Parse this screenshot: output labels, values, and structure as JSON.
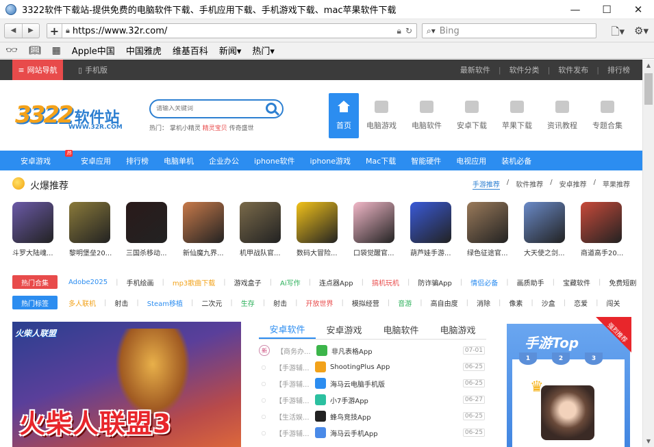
{
  "window": {
    "title": "3322软件下载站-提供免费的电脑软件下载、手机应用下载、手机游戏下载、mac苹果软件下载",
    "controls": {
      "minimize": "—",
      "maximize": "☐",
      "close": "✕"
    }
  },
  "toolbar": {
    "url": "https://www.32r.com/",
    "search_placeholder": "Bing"
  },
  "bookmarks": [
    "Apple中国",
    "中国雅虎",
    "维基百科",
    "新闻▾",
    "热门▾"
  ],
  "topbar": {
    "nav_label": "网站导航",
    "mobile_label": "手机版",
    "right_links": [
      "最新软件",
      "软件分类",
      "软件发布",
      "排行榜"
    ]
  },
  "header": {
    "logo_num": "3322",
    "logo_text": "软件站",
    "logo_sub": "WWW.32R.COM",
    "search_placeholder": "请输入关键词",
    "hot_prefix": "热门：",
    "hot_items": [
      "掌机小精灵",
      "精灵宝贝",
      "传奇盛世"
    ],
    "categories": [
      "首页",
      "电脑游戏",
      "电脑软件",
      "安卓下载",
      "苹果下载",
      "资讯教程",
      "专题合集"
    ]
  },
  "bluenav": {
    "items": [
      "安卓游戏",
      "安卓应用",
      "排行榜",
      "电脑单机",
      "企业办公",
      "iphone软件",
      "iphone游戏",
      "Mac下载",
      "智能硬件",
      "电视应用",
      "装机必备"
    ],
    "badge": "热"
  },
  "hot_section": {
    "title": "火爆推荐",
    "tabs": [
      "手游推荐",
      "软件推荐",
      "安卓推荐",
      "苹果推荐"
    ],
    "tab_sep": "/",
    "games": [
      {
        "name": "斗罗大陆魂...",
        "color": "#6b5aa8"
      },
      {
        "name": "黎明堡垒20...",
        "color": "#8a7a3a"
      },
      {
        "name": "三国杀移动...",
        "color": "#2a1a1a"
      },
      {
        "name": "新仙魔九界...",
        "color": "#c87a4a"
      },
      {
        "name": "机甲战队官...",
        "color": "#7a6a4a"
      },
      {
        "name": "数码大冒险...",
        "color": "#f2c21a"
      },
      {
        "name": "口袋觉醒官...",
        "color": "#f2b8c8"
      },
      {
        "name": "葫芦娃手游...",
        "color": "#3a5ad8"
      },
      {
        "name": "绿色征途官...",
        "color": "#9a7a5a"
      },
      {
        "name": "大天使之剑...",
        "color": "#6a8ac8"
      },
      {
        "name": "商道高手20...",
        "color": "#c84a3a"
      }
    ]
  },
  "tags": {
    "row1_label": "热门合集",
    "row1": [
      {
        "t": "Adobe2025",
        "c": "#2c8df0"
      },
      {
        "t": "手机绘画",
        "c": "#333"
      },
      {
        "t": "mp3歌曲下载",
        "c": "#f2a21a"
      },
      {
        "t": "游戏盒子",
        "c": "#333"
      },
      {
        "t": "Ai写作",
        "c": "#2cb05a"
      },
      {
        "t": "连点器App",
        "c": "#333"
      },
      {
        "t": "搞机玩机",
        "c": "#e84b4b"
      },
      {
        "t": "防诈骗App",
        "c": "#333"
      },
      {
        "t": "情侣必备",
        "c": "#2c8df0"
      },
      {
        "t": "画质助手",
        "c": "#333"
      },
      {
        "t": "宝藏软件",
        "c": "#333"
      },
      {
        "t": "免费短剧",
        "c": "#333"
      }
    ],
    "row2_label": "热门标签",
    "row2": [
      {
        "t": "多人联机",
        "c": "#f2a21a"
      },
      {
        "t": "射击",
        "c": "#333"
      },
      {
        "t": "Steam移植",
        "c": "#2c8df0"
      },
      {
        "t": "二次元",
        "c": "#333"
      },
      {
        "t": "生存",
        "c": "#2cb05a"
      },
      {
        "t": "射击",
        "c": "#333"
      },
      {
        "t": "开放世界",
        "c": "#e84b4b"
      },
      {
        "t": "模拟经营",
        "c": "#333"
      },
      {
        "t": "音游",
        "c": "#2cb05a"
      },
      {
        "t": "高自由度",
        "c": "#333"
      },
      {
        "t": "消除",
        "c": "#333"
      },
      {
        "t": "像素",
        "c": "#333"
      },
      {
        "t": "沙盒",
        "c": "#333"
      },
      {
        "t": "恋爱",
        "c": "#333"
      },
      {
        "t": "闯关",
        "c": "#333"
      }
    ],
    "sep": "|"
  },
  "banner": {
    "small_title": "火柴人联盟",
    "big_title": "火柴人联盟3"
  },
  "applist": {
    "tabs": [
      "安卓软件",
      "安卓游戏",
      "电脑软件",
      "电脑游戏"
    ],
    "new_label": "新",
    "rows": [
      {
        "cat": "【商务办...",
        "name": "非凡表格App",
        "date": "07-01",
        "color": "#3cb54a"
      },
      {
        "cat": "【手游辅...",
        "name": "ShootingPlus App",
        "date": "06-25",
        "color": "#f2a21a"
      },
      {
        "cat": "【手游辅...",
        "name": "海马云电脑手机版",
        "date": "06-25",
        "color": "#2c8df0"
      },
      {
        "cat": "【手游辅...",
        "name": "小7手游App",
        "date": "06-27",
        "color": "#2cc0a0"
      },
      {
        "cat": "【生活娱...",
        "name": "蜂鸟竞技App",
        "date": "06-25",
        "color": "#222"
      },
      {
        "cat": "【手游辅...",
        "name": "海马云手机App",
        "date": "06-25",
        "color": "#4a8ae8"
      }
    ]
  },
  "rank": {
    "title": "手游Top",
    "ribbon": "强烈推荐",
    "top_label": "TOP",
    "nums": [
      "1",
      "2",
      "3"
    ]
  }
}
